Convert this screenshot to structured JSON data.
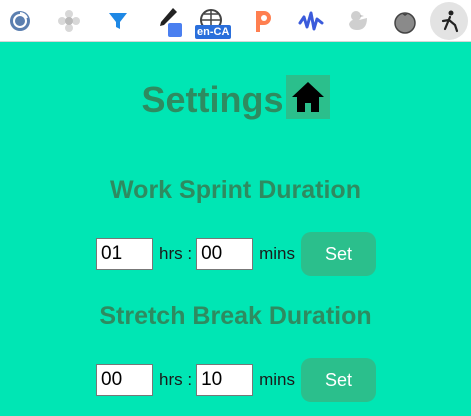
{
  "toolbar": {
    "extensions": [
      {
        "name": "circle-refresh-icon"
      },
      {
        "name": "gear-flower-icon"
      },
      {
        "name": "funnel-icon"
      },
      {
        "name": "eyedropper-icon"
      },
      {
        "name": "globe-language-icon",
        "badge": "en-CA"
      },
      {
        "name": "p-logo-icon"
      },
      {
        "name": "audio-wave-icon"
      },
      {
        "name": "duck-icon"
      },
      {
        "name": "tomato-icon"
      },
      {
        "name": "stretch-person-icon"
      }
    ],
    "colors": {
      "wave": "#3b5bdb",
      "p_logo": "#ff7f50",
      "funnel": "#1e88e5"
    }
  },
  "page": {
    "title": "Settings",
    "home_icon": "home-icon"
  },
  "work": {
    "heading": "Work Sprint Duration",
    "hours": "01",
    "hours_unit": "hrs :",
    "minutes": "00",
    "minutes_unit": "mins",
    "set_label": "Set"
  },
  "stretch": {
    "heading": "Stretch Break Duration",
    "hours": "00",
    "hours_unit": "hrs :",
    "minutes": "10",
    "minutes_unit": "mins",
    "set_label": "Set"
  },
  "theme": {
    "background": "#00e6b4",
    "heading_color": "#2e8b60",
    "button_color": "#2bbf8c"
  }
}
